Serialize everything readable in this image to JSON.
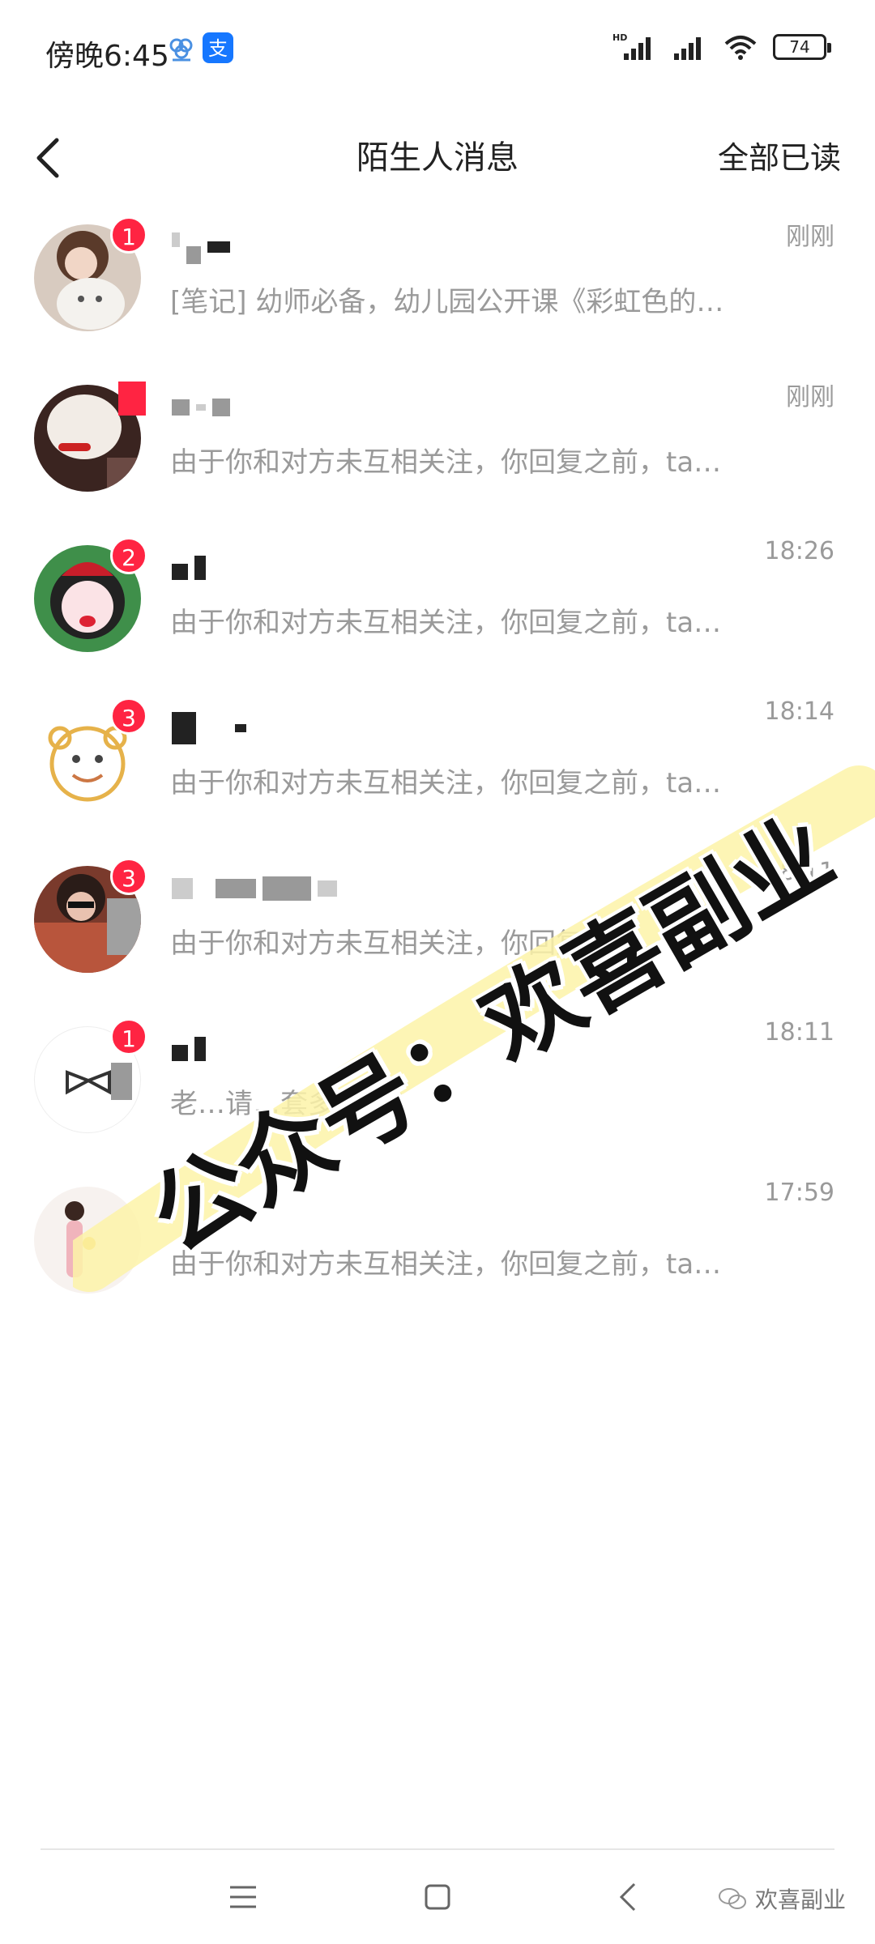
{
  "status_bar": {
    "time": "傍晚6:45",
    "battery": "74",
    "icons": [
      "cloud-app-icon",
      "alipay-icon",
      "hd-signal-icon",
      "signal-icon",
      "wifi-icon",
      "battery-icon"
    ]
  },
  "header": {
    "title": "陌生人消息",
    "mark_all_read": "全部已读",
    "back_icon": "chevron-left-icon"
  },
  "messages": [
    {
      "time": "刚刚",
      "preview": "[笔记] 幼师必备，幼儿园公开课《彩虹色的…",
      "badge": "1"
    },
    {
      "time": "刚刚",
      "preview": "由于你和对方未互相关注，你回复之前，ta…",
      "badge": ""
    },
    {
      "time": "18:26",
      "preview": "由于你和对方未互相关注，你回复之前，ta…",
      "badge": "2"
    },
    {
      "time": "18:14",
      "preview": "由于你和对方未互相关注，你回复之前，ta…",
      "badge": "3"
    },
    {
      "time": "18:11",
      "preview": "由于你和对方未互相关注，你回复之前，ta…",
      "badge": "3"
    },
    {
      "time": "18:11",
      "preview": "老…请…套多少钱?",
      "badge": "1"
    },
    {
      "time": "17:59",
      "preview": "由于你和对方未互相关注，你回复之前，ta…",
      "badge": ""
    }
  ],
  "watermark": {
    "text": "公众号：欢喜副业"
  },
  "nav": {
    "icons": [
      "menu-icon",
      "home-icon",
      "back-icon"
    ],
    "wechat_label": "欢喜副业"
  },
  "colors": {
    "badge": "#ff2442",
    "secondary_text": "#9a9a9a",
    "watermark_highlight": "#fdf3a8"
  }
}
